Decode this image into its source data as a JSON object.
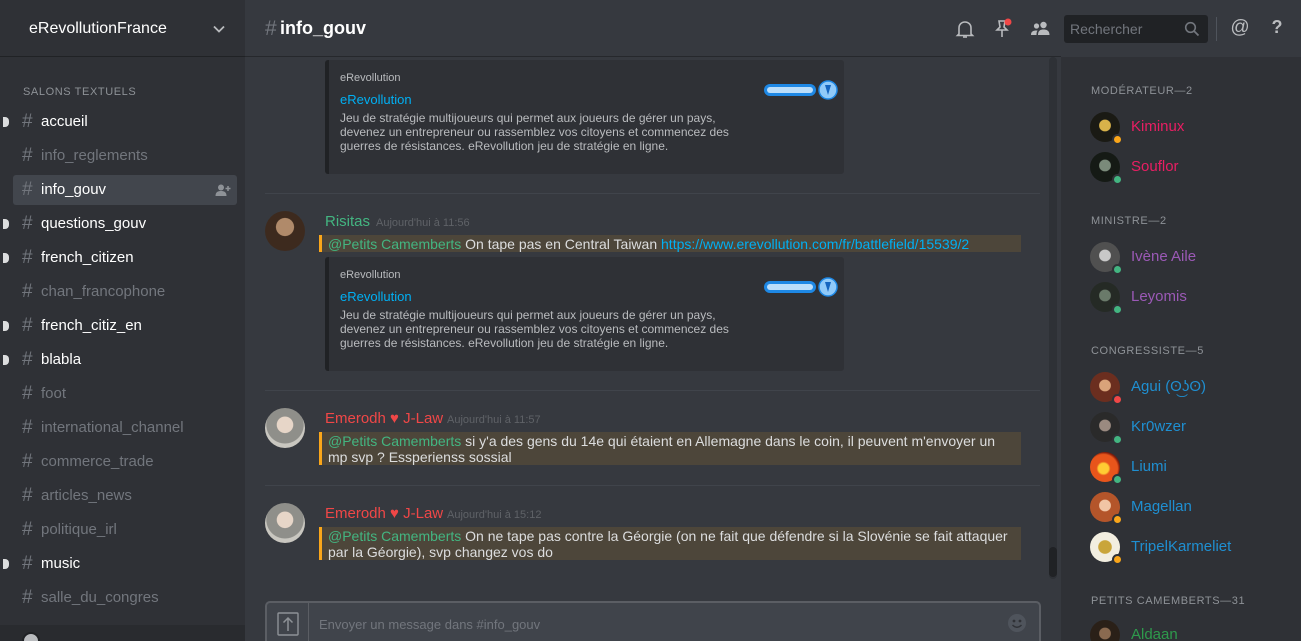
{
  "server": {
    "name": "eRevollutionFrance"
  },
  "channels": {
    "section_label": "SALONS TEXTUELS",
    "items": [
      {
        "name": "accueil",
        "state": "unread"
      },
      {
        "name": "info_reglements",
        "state": "read"
      },
      {
        "name": "info_gouv",
        "state": "selected"
      },
      {
        "name": "questions_gouv",
        "state": "unread"
      },
      {
        "name": "french_citizen",
        "state": "unread"
      },
      {
        "name": "chan_francophone",
        "state": "read"
      },
      {
        "name": "french_citiz_en",
        "state": "unread"
      },
      {
        "name": "blabla",
        "state": "unread"
      },
      {
        "name": "foot",
        "state": "read"
      },
      {
        "name": "international_channel",
        "state": "read"
      },
      {
        "name": "commerce_trade",
        "state": "read"
      },
      {
        "name": "articles_news",
        "state": "read"
      },
      {
        "name": "politique_irl",
        "state": "read"
      },
      {
        "name": "music",
        "state": "unread"
      },
      {
        "name": "salle_du_congres",
        "state": "read"
      }
    ]
  },
  "header": {
    "hash": "#",
    "channel_name": "info_gouv",
    "search_placeholder": "Rechercher",
    "icons": [
      "bell-icon",
      "pin-icon",
      "members-icon",
      "search-icon",
      "mention-icon",
      "help-icon"
    ],
    "mention_symbol": "@",
    "help_symbol": "?"
  },
  "embed_common": {
    "provider": "eRevollution",
    "title": "eRevollution",
    "description": "Jeu de stratégie multijoueurs qui permet aux joueurs de gérer un pays, devenez un entrepreneur ou rassemblez vos citoyens et commencez des guerres de résistances. eRevollution jeu de stratégie en ligne."
  },
  "messages": [
    {
      "author": "Risitas",
      "author_color": "#43b581",
      "time": "Aujourd'hui à 11:56",
      "mention": "@Petits Camemberts",
      "text": " On tape pas en Central Taiwan ",
      "link": "https://www.erevollution.com/fr/battlefield/15539/2"
    },
    {
      "author": "Emerodh ♥ J-Law",
      "author_color": "#f04747",
      "time": "Aujourd'hui à 11:57",
      "mention": "@Petits Camemberts",
      "text": " si y'a des gens du 14e qui étaient en Allemagne dans le coin, il peuvent m'envoyer un mp svp ? Essperienss sossial"
    },
    {
      "author": "Emerodh ♥ J-Law",
      "author_color": "#f04747",
      "time": "Aujourd'hui à 15:12",
      "mention": "@Petits Camemberts",
      "text": " On ne tape pas contre la Géorgie (on ne fait que défendre si la Slovénie se fait attaquer par la Géorgie), svp changez vos do"
    }
  ],
  "composer": {
    "placeholder": "Envoyer un message dans #info_gouv"
  },
  "members": {
    "groups": [
      {
        "label": "MODÉRATEUR—2",
        "members": [
          {
            "name": "Kiminux",
            "color": "#e91e63",
            "status": "idle"
          },
          {
            "name": "Souflor",
            "color": "#e91e63",
            "status": "online"
          }
        ]
      },
      {
        "label": "MINISTRE—2",
        "members": [
          {
            "name": "Ivène Aile",
            "color": "#9b59b6",
            "status": "online"
          },
          {
            "name": "Leyomis",
            "color": "#9b59b6",
            "status": "online"
          }
        ]
      },
      {
        "label": "CONGRESSISTE—5",
        "members": [
          {
            "name": "Agui (ʘ͜ʖʘ)",
            "color": "#1f8fd1",
            "status": "dnd"
          },
          {
            "name": "Kr0wzer",
            "color": "#1f8fd1",
            "status": "online"
          },
          {
            "name": "Liumi",
            "color": "#1f8fd1",
            "status": "online"
          },
          {
            "name": "Magellan",
            "color": "#1f8fd1",
            "status": "idle"
          },
          {
            "name": "TripelKarmeliet",
            "color": "#1f8fd1",
            "status": "idle"
          }
        ]
      },
      {
        "label": "PETITS CAMEMBERTS—31",
        "members": [
          {
            "name": "Aldaan",
            "color": "#2e9a4c",
            "status": "online"
          }
        ]
      }
    ]
  },
  "status_colors": {
    "online": "#43b581",
    "idle": "#faa61a",
    "dnd": "#f04747"
  }
}
